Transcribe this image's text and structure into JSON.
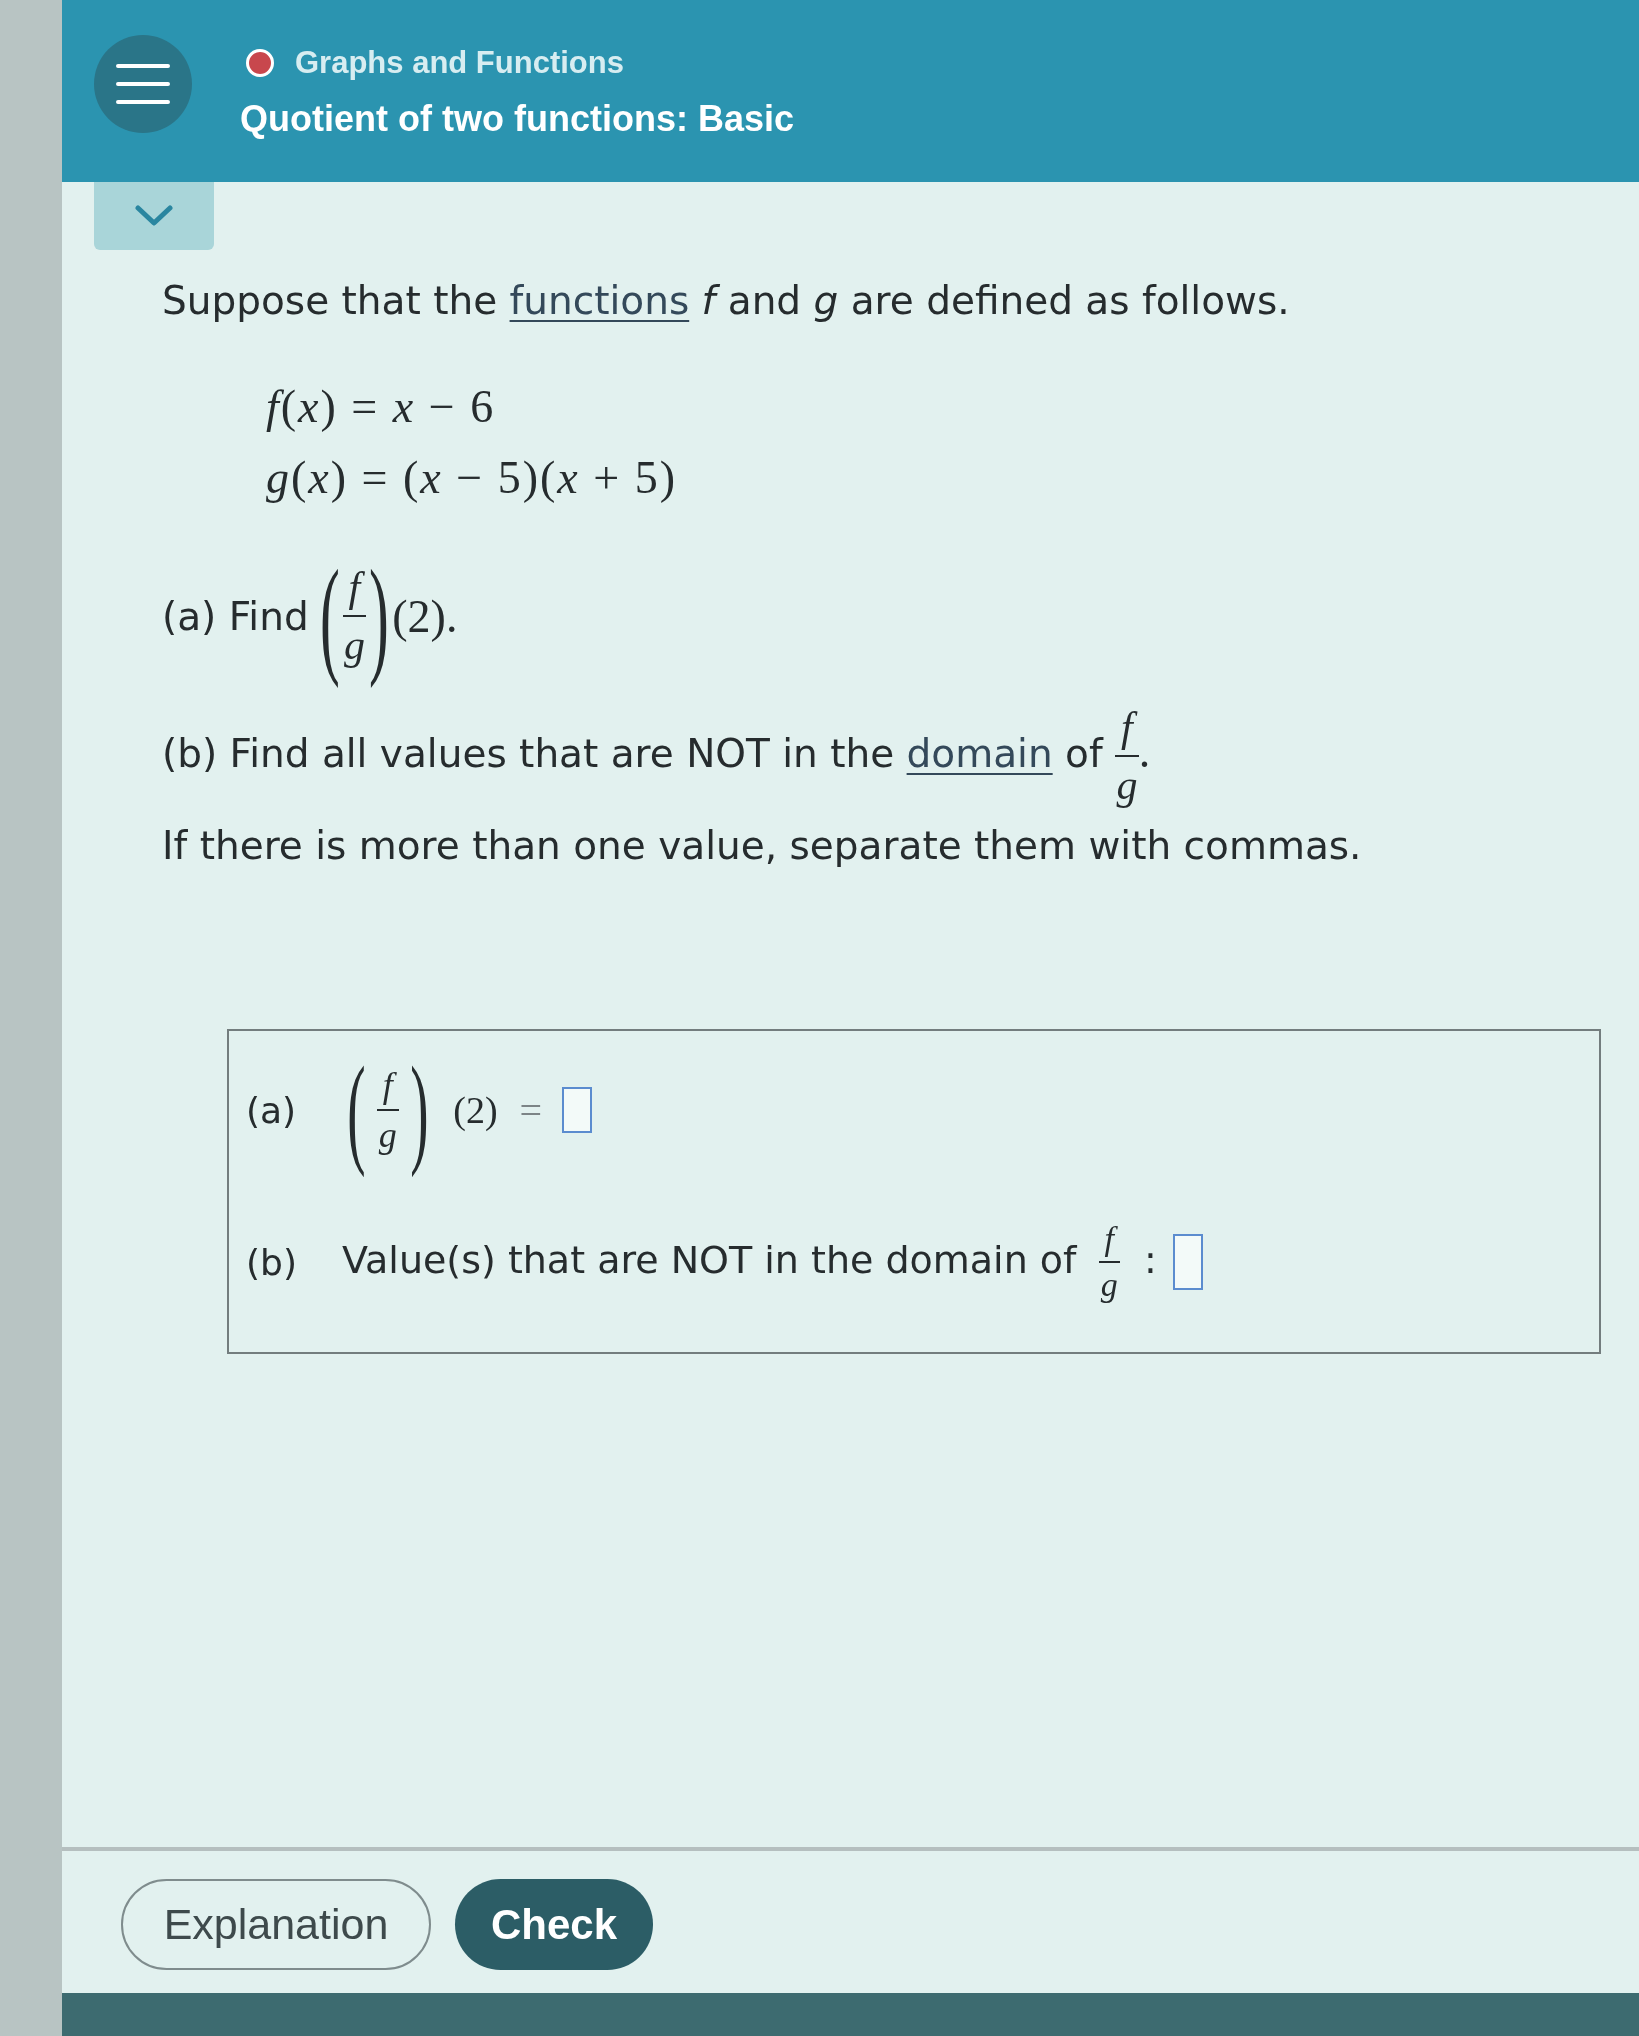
{
  "header": {
    "topic": "Graphs and Functions",
    "title": "Quotient of two functions: Basic"
  },
  "problem": {
    "intro": {
      "before": "Suppose that the",
      "link": "functions",
      "after": "*f* and *g* are defined as follows."
    },
    "equations": [
      "*f*(*x*) = *x* − 6",
      "*g*(*x*) = (*x* − 5)(*x* + 5)"
    ],
    "part_a": {
      "label": "(a) Find",
      "open": "(",
      "numerator": "f",
      "denominator": "g",
      "close": ")",
      "tail": "(2)."
    },
    "part_b": {
      "before": "(b) Find all values that are NOT in the",
      "link": "domain",
      "after": "of",
      "numerator": "f",
      "denominator": "g",
      "tail": "."
    },
    "instruction": "If there is more than one value, separate them with commas."
  },
  "answers": [
    {
      "kind": "evaluate",
      "label": "(a)",
      "open": "(",
      "numerator": "f",
      "denominator": "g",
      "close": ")",
      "argument": "(2)",
      "equals": "="
    },
    {
      "kind": "domain",
      "label": "(b)",
      "text": "Value(s) that are NOT in the domain of",
      "numerator": "f",
      "denominator": "g",
      "separator": ":"
    }
  ],
  "buttons": [
    {
      "kind": "secondary",
      "label": "Explanation"
    },
    {
      "kind": "primary",
      "label": "Check"
    }
  ]
}
